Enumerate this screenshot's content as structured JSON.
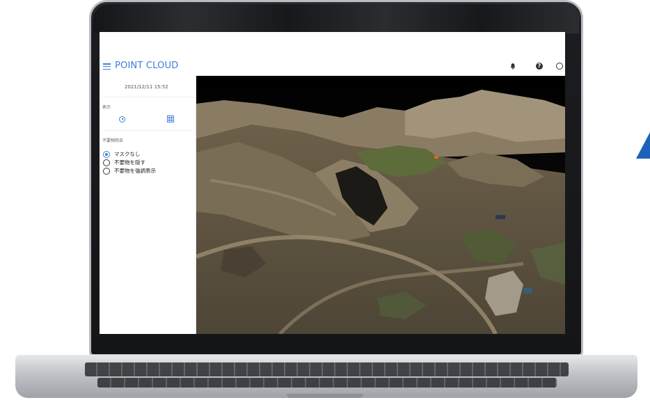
{
  "app": {
    "title": "POINT CLOUD",
    "accent_color": "#3d7fd8"
  },
  "header_icons": [
    "bell-icon",
    "help-icon",
    "account-icon"
  ],
  "sidebar": {
    "timestamp": "2021/12/11 15:52",
    "display_section_label": "表示",
    "display_controls": [
      "rotate-icon",
      "grid-view-icon"
    ],
    "filter_section_label": "不要物除去",
    "options": [
      {
        "label": "マスクなし",
        "selected": true
      },
      {
        "label": "不要物を隠す",
        "selected": false
      },
      {
        "label": "不要物を強調表示",
        "selected": false
      }
    ]
  },
  "viewer": {
    "content": "point-cloud-terrain"
  }
}
